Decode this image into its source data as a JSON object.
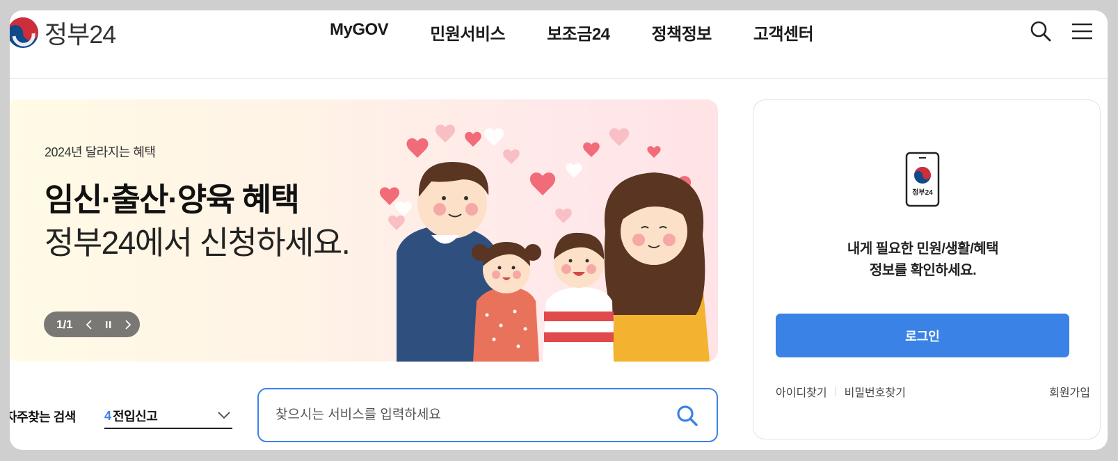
{
  "header": {
    "logo_text": "정부24",
    "nav": [
      "MyGOV",
      "민원서비스",
      "보조금24",
      "정책정보",
      "고객센터"
    ],
    "search_icon": "search-icon",
    "menu_icon": "hamburger-menu-icon"
  },
  "banner": {
    "eyebrow": "2024년 달라지는 혜택",
    "title": "임신·출산·양육 혜택",
    "subtitle": "정부24에서 신청하세요.",
    "counter": "1/1"
  },
  "login": {
    "phone_caption": "정부24",
    "message_line1": "내게 필요한 민원/생활/혜택",
    "message_line2": "정보를 확인하세요.",
    "login_label": "로그인",
    "find_id": "아이디찾기",
    "find_pw": "비밀번호찾기",
    "join": "회원가입"
  },
  "search": {
    "freq_label": "자주찾는 검색",
    "freq_rank": "4",
    "freq_value": "전입신고",
    "placeholder": "찾으시는 서비스를 입력하세요"
  },
  "colors": {
    "accent": "#3a82e6",
    "taeguk_red": "#cd2e3a",
    "taeguk_blue": "#0f4a8a"
  }
}
